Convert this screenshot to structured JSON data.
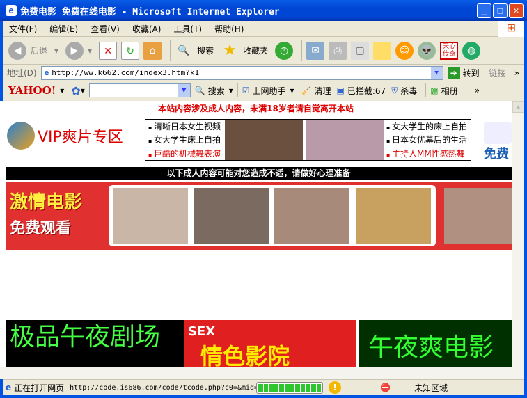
{
  "window": {
    "title": "免费电影 免费在线电影 - Microsoft Internet Explorer"
  },
  "menu": [
    "文件(F)",
    "编辑(E)",
    "查看(V)",
    "收藏(A)",
    "工具(T)",
    "帮助(H)"
  ],
  "toolbar": {
    "back": "后退",
    "search": "搜索",
    "favorites": "收藏夹"
  },
  "address": {
    "label": "地址(D)",
    "url": "http://ww.k662.com/index3.htm?k1",
    "go": "转到",
    "links": "链接"
  },
  "yahoo_bar": {
    "logo": "YAHOO!",
    "search": "搜索",
    "assistant": "上网助手",
    "clean": "清理",
    "blocked": "已拦截:67",
    "antivirus": "杀毒",
    "album": "相册"
  },
  "page": {
    "warning": "本站内容涉及成人内容，未满18岁者请自觉离开本站",
    "vip": "VIP爽片专区",
    "left_links": [
      "清晰日本女生视频",
      "女大学生床上自拍",
      "巨酷的机械舞表演"
    ],
    "right_links": [
      "女大学生的床上自拍",
      "日本女优幕后的生活",
      "主持人MM性感热舞"
    ],
    "side": "免费",
    "notice": "以下成人内容可能对您造成不适，请做好心理准备",
    "band_title": "激情电影",
    "band_sub": "免费观看",
    "banner1": "极品午夜剧场",
    "banner2_tag": "SEX",
    "banner2": "情色影院",
    "banner3": "午夜爽电影"
  },
  "status": {
    "text": "正在打开网页",
    "url": "http://code.is686.com/code/tcode.php?c0=&mid=",
    "progress": 1.0,
    "zone": "未知区域"
  }
}
